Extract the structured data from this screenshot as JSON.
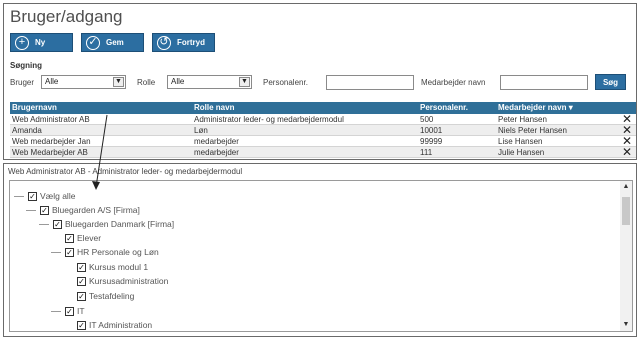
{
  "page": {
    "title": "Bruger/adgang"
  },
  "toolbar": {
    "new_label": "Ny",
    "save_label": "Gem",
    "cancel_label": "Fortryd"
  },
  "search": {
    "heading": "Søgning",
    "user_label": "Bruger",
    "user_value": "Alle",
    "role_label": "Rolle",
    "role_value": "Alle",
    "personnel_label": "Personalenr.",
    "personnel_value": "",
    "employee_label": "Medarbejder navn",
    "employee_value": "",
    "button_label": "Søg"
  },
  "grid": {
    "headers": {
      "username": "Brugernavn",
      "role": "Rolle navn",
      "personnel": "Personalenr.",
      "employee": "Medarbejder navn"
    },
    "sort_indicator": "▾",
    "delete_glyph": "✕",
    "rows": [
      {
        "username": "Web Administrator AB",
        "role": "Administrator leder- og medarbejdermodul",
        "personnel": "500",
        "employee": "Peter Hansen"
      },
      {
        "username": "Amanda",
        "role": "Løn",
        "personnel": "10001",
        "employee": "Niels Peter Hansen"
      },
      {
        "username": "Web medarbejder Jan",
        "role": "medarbejder",
        "personnel": "99999",
        "employee": "Lise Hansen"
      },
      {
        "username": "Web Medarbejder AB",
        "role": "medarbejder",
        "personnel": "111",
        "employee": "Julie Hansen"
      }
    ]
  },
  "detail": {
    "title": "Web Administrator AB - Administrator leder- og medarbejdermodul",
    "tree": [
      {
        "label": "Vælg alle",
        "checked": true
      },
      {
        "label": "Bluegarden A/S [Firma]",
        "checked": true
      },
      {
        "label": "Bluegarden Danmark [Firma]",
        "checked": true
      },
      {
        "label": "Elever",
        "checked": true
      },
      {
        "label": "HR Personale og Løn",
        "checked": true
      },
      {
        "label": "Kursus modul 1",
        "checked": true
      },
      {
        "label": "Kursusadministration",
        "checked": true
      },
      {
        "label": "Testafdeling",
        "checked": true
      },
      {
        "label": "IT",
        "checked": true
      },
      {
        "label": "IT Administration",
        "checked": true
      }
    ]
  },
  "colors": {
    "accent": "#2c6ea1",
    "grid_header": "#2f6f98",
    "row_alt": "#eeeeee"
  },
  "icons": {
    "new": "plus-circle-icon",
    "save": "check-circle-icon",
    "cancel": "undo-circle-icon",
    "delete": "close-icon",
    "dropdown": "chevron-down-icon"
  }
}
